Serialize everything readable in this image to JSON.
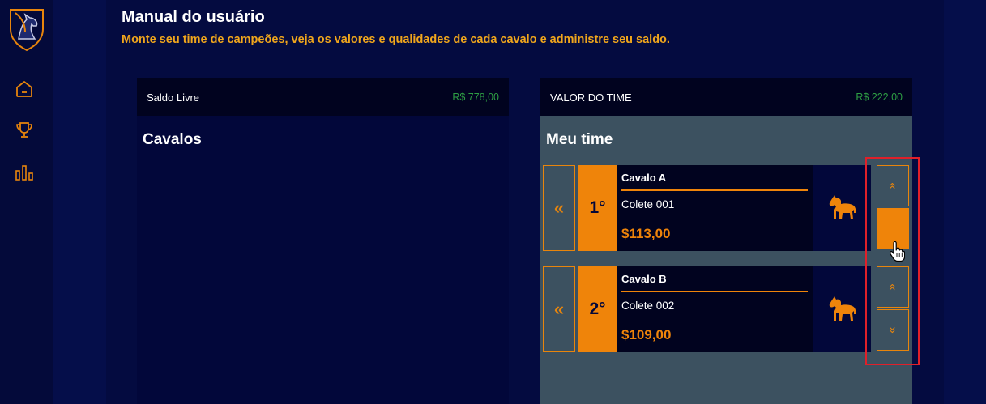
{
  "sidebar": {
    "logo": "horse-logo-icon",
    "items": [
      {
        "icon": "home-icon"
      },
      {
        "icon": "trophy-icon"
      },
      {
        "icon": "chart-icon"
      }
    ]
  },
  "header": {
    "title": "Manual do usuário",
    "subtitle": "Monte seu time de campeões, veja os valores e qualidades de cada cavalo e administre seu saldo."
  },
  "left_panel": {
    "label": "Saldo Livre",
    "value": "R$ 778,00",
    "section_title": "Cavalos"
  },
  "right_panel": {
    "label": "VALOR DO TIME",
    "value": "R$ 222,00",
    "section_title": "Meu time",
    "horses": [
      {
        "rank": "1°",
        "name": "Cavalo A",
        "colete": "Colete 001",
        "price": "$113,00"
      },
      {
        "rank": "2°",
        "name": "Cavalo B",
        "colete": "Colete 002",
        "price": "$109,00"
      }
    ]
  },
  "icons": {
    "remove": "«",
    "up": "«",
    "down": "»"
  },
  "colors": {
    "accent": "#ef840a",
    "subtitle": "#f0a61c",
    "value_green": "#2e9e44",
    "panel_right_bg": "#3c5160",
    "highlight": "#e0202a"
  }
}
